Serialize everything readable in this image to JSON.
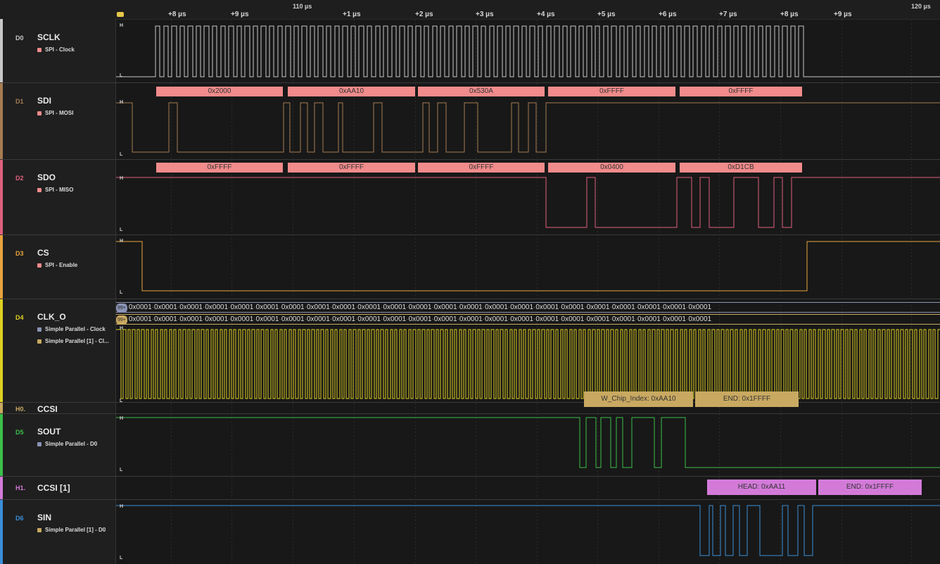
{
  "ruler": {
    "major": [
      "110 µs",
      "120 µs"
    ],
    "minor": [
      "+8 µs",
      "+9 µs",
      "+1 µs",
      "+2 µs",
      "+3 µs",
      "+4 µs",
      "+5 µs",
      "+6 µs",
      "+7 µs",
      "+8 µs",
      "+9 µs"
    ]
  },
  "channels": [
    {
      "id": "D0",
      "name": "SCLK",
      "color": "#c8c8c8",
      "analyzers": [
        {
          "label": "SPI - Clock",
          "color": "#f28b8b"
        }
      ]
    },
    {
      "id": "D1",
      "name": "SDI",
      "color": "#a67c52",
      "analyzers": [
        {
          "label": "SPI - MOSI",
          "color": "#f28b8b"
        }
      ]
    },
    {
      "id": "D2",
      "name": "SDO",
      "color": "#e0607e",
      "analyzers": [
        {
          "label": "SPI - MISO",
          "color": "#f28b8b"
        }
      ]
    },
    {
      "id": "D3",
      "name": "CS",
      "color": "#e8a33c",
      "analyzers": [
        {
          "label": "SPI - Enable",
          "color": "#f28b8b"
        }
      ]
    },
    {
      "id": "D4",
      "name": "CLK_O",
      "color": "#e0d020",
      "analyzers": [
        {
          "label": "Simple Parallel - Clock",
          "color": "#8a93b5"
        },
        {
          "label": "Simple Parallel [1] - Cl...",
          "color": "#c9a961"
        }
      ]
    },
    {
      "id": "H0.",
      "name": "CCSI",
      "color": "#c9a961",
      "analyzers": []
    },
    {
      "id": "D5",
      "name": "SOUT",
      "color": "#3cbf4a",
      "analyzers": [
        {
          "label": "Simple Parallel - D0",
          "color": "#8a93b5"
        }
      ]
    },
    {
      "id": "H1.",
      "name": "CCSI [1]",
      "color": "#d37ad9",
      "analyzers": []
    },
    {
      "id": "D6",
      "name": "SIN",
      "color": "#3a8fd9",
      "analyzers": [
        {
          "label": "Simple Parallel [1] - D0",
          "color": "#c9a961"
        }
      ]
    }
  ],
  "level_labels": {
    "high": "H",
    "low": "L"
  },
  "sdi_frames": [
    "0x2000",
    "0xAA10",
    "0x530A",
    "0xFFFF",
    "0xFFFF"
  ],
  "sdo_frames": [
    "0xFFFF",
    "0xFFFF",
    "0xFFFF",
    "0x0400",
    "0xD1CB"
  ],
  "parallel": {
    "badge": "99+",
    "value": "0x0001",
    "row1_color": "#8a93b5",
    "row2_color": "#c9a961"
  },
  "ccsi_frames": [
    "W_Chip_Index: 0xAA10",
    "END: 0x1FFFF"
  ],
  "ccsi1_frames": [
    "HEAD: 0xAA11",
    "END: 0x1FFFF"
  ]
}
